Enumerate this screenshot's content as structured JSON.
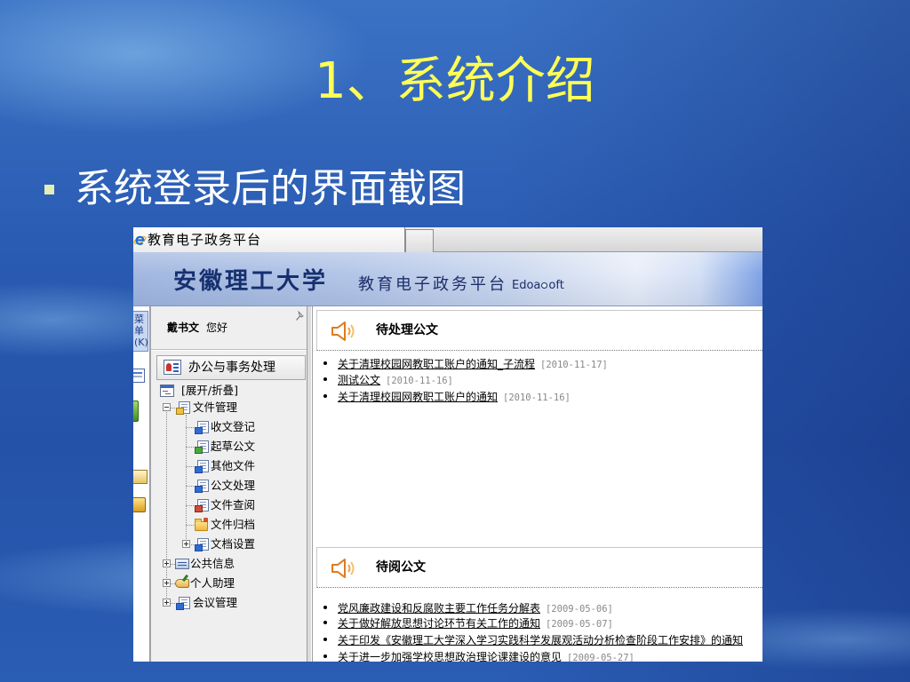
{
  "slide": {
    "title": "1、系统介绍",
    "bullet": "系统登录后的界面截图"
  },
  "colors": {
    "slide_background": "#2a5cb3",
    "title": "#ffff55",
    "bullet_marker": "#e4eeb4",
    "bullet_text": "#ffffff",
    "banner_text": "#16306f",
    "speaker_icon": "#e07a1f",
    "date_text": "#888888"
  },
  "browser": {
    "tab_title": "教育电子政务平台",
    "tab_icon": "ie-icon"
  },
  "banner": {
    "university": "安徽理工大学",
    "platform": "教育电子政务平台",
    "logo_left": "Edoa",
    "logo_right": "oft"
  },
  "left_strip": {
    "menu_label": "菜单(K)"
  },
  "sidebar": {
    "user_name": "戴书文",
    "greeting": "您好",
    "module": "办公与事务处理",
    "toggle_label": "[展开/折叠]",
    "tree": [
      {
        "label": "文件管理",
        "expanded": true,
        "icon": "document-folder-icon",
        "children": [
          {
            "label": "收文登记",
            "icon": "receive-document-icon"
          },
          {
            "label": "起草公文",
            "icon": "draft-document-icon"
          },
          {
            "label": "其他文件",
            "icon": "other-files-icon"
          },
          {
            "label": "公文处理",
            "icon": "process-document-icon"
          },
          {
            "label": "文件查阅",
            "icon": "view-document-icon"
          },
          {
            "label": "文件归档",
            "icon": "archive-folder-icon"
          },
          {
            "label": "文档设置",
            "icon": "document-settings-icon",
            "expanded": false
          }
        ]
      },
      {
        "label": "公共信息",
        "expanded": false,
        "icon": "public-info-icon"
      },
      {
        "label": "个人助理",
        "expanded": false,
        "icon": "personal-assistant-icon"
      },
      {
        "label": "会议管理",
        "expanded": false,
        "icon": "meeting-icon"
      }
    ]
  },
  "main": {
    "sections": [
      {
        "title": "待处理公文",
        "items": [
          {
            "text": "关于清理校园网教职工账户的通知_子流程",
            "date": "[2010-11-17]"
          },
          {
            "text": "测试公文",
            "date": "[2010-11-16]"
          },
          {
            "text": "关于清理校园网教职工账户的通知",
            "date": "[2010-11-16]"
          }
        ]
      },
      {
        "title": "待阅公文",
        "items": [
          {
            "text": "党风廉政建设和反腐败主要工作任务分解表",
            "date": "[2009-05-06]"
          },
          {
            "text": "关于做好解放思想讨论环节有关工作的通知",
            "date": "[2009-05-07]"
          },
          {
            "text": "关于印发《安徽理工大学深入学习实践科学发展观活动分析检查阶段工作安排》的通知"
          },
          {
            "text": "关于进一步加强学校思想政治理论课建设的意见",
            "date": "[2009-05-27]"
          }
        ]
      }
    ]
  }
}
